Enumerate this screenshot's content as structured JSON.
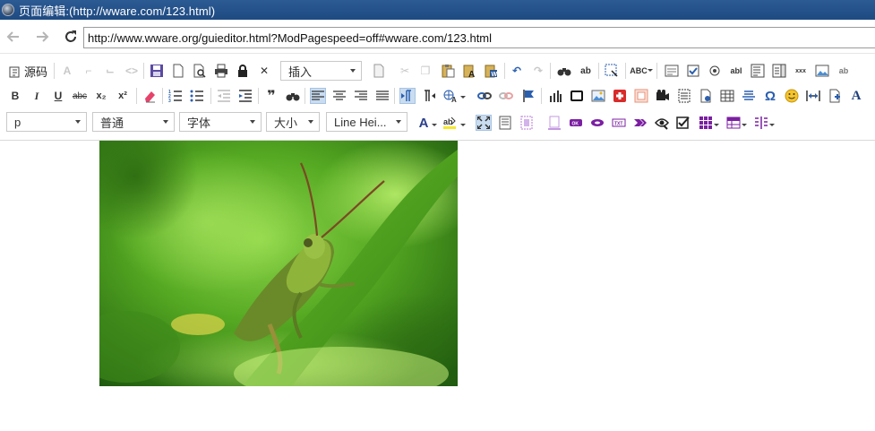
{
  "window": {
    "title": "页面编辑:(http://wware.com/123.html)"
  },
  "browser": {
    "url": "http://www.wware.org/guieditor.html?ModPagespeed=off#wware.com/123.html",
    "back_icon": "back-arrow-icon",
    "forward_icon": "forward-arrow-icon",
    "refresh_icon": "refresh-icon"
  },
  "toolbar1": {
    "source_label": "源码",
    "insert_combo": "插入"
  },
  "toolbar2": {
    "bold": "B",
    "italic": "I",
    "underline": "U",
    "strike": "abc",
    "subscript": "x₂",
    "superscript": "x²"
  },
  "toolbar3": {
    "paragraph_combo": "p",
    "style_combo": "普通",
    "font_combo": "字体",
    "size_combo": "大小",
    "line_height_combo": "Line Hei..."
  },
  "colors": {
    "title_bar": "#1e4a82",
    "active_button": "#c9dcf0",
    "grasshopper_bg": "#6cc12e"
  }
}
